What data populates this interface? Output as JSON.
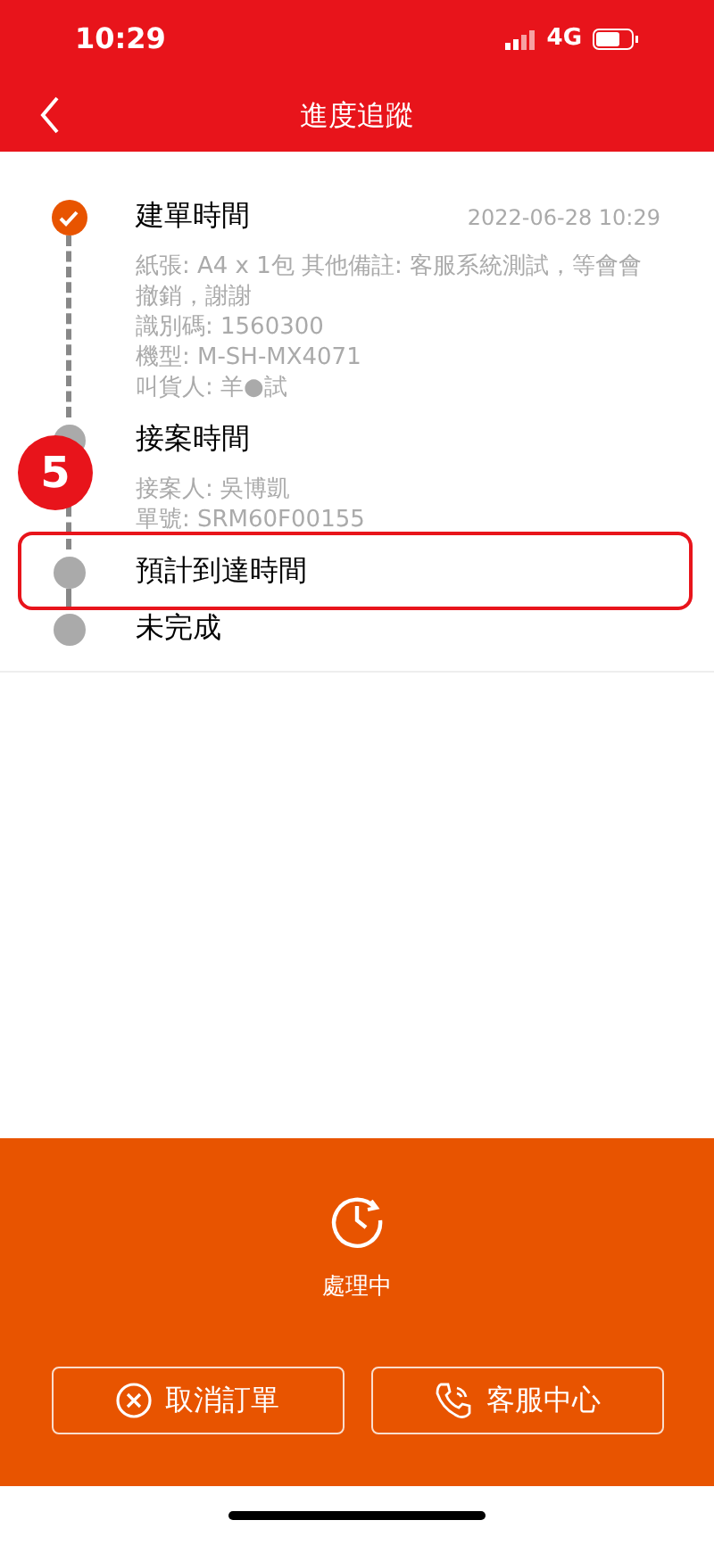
{
  "status_bar": {
    "time": "10:29",
    "network": "4G"
  },
  "header": {
    "title": "進度追蹤"
  },
  "steps": [
    {
      "title": "建單時間",
      "time": "2022-06-28 10:29",
      "completed": true,
      "highlighted": false,
      "details": [
        "紙張: A4 x 1包  其他備註: 客服系統測試，等會會撤銷，謝謝",
        "識別碼: 1560300",
        "機型: M-SH-MX4071",
        "叫貨人: 羊●試"
      ]
    },
    {
      "title": "接案時間",
      "completed": false,
      "highlighted": false,
      "details": [
        "接案人: 吳博凱",
        "單號: SRM60F00155"
      ]
    },
    {
      "title": "預計到達時間",
      "completed": false,
      "highlighted": true
    },
    {
      "title": "未完成",
      "completed": false,
      "highlighted": false
    }
  ],
  "annotation": {
    "badge": "5"
  },
  "status_panel": {
    "label": "處理中"
  },
  "buttons": [
    {
      "kind": "cancel",
      "label": "取消訂單"
    },
    {
      "kind": "call",
      "label": "客服中心"
    }
  ]
}
